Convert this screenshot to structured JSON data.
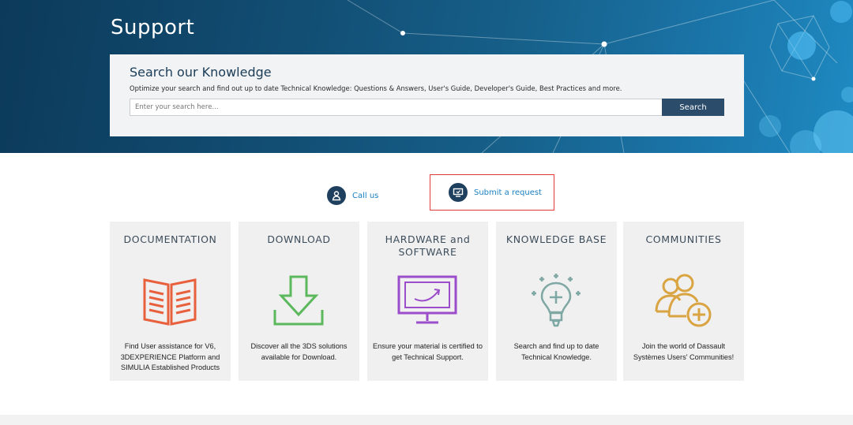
{
  "hero": {
    "title": "Support"
  },
  "search": {
    "title": "Search our Knowledge",
    "subtitle": "Optimize your search and find out up to date Technical Knowledge: Questions & Answers, User's Guide, Developer's Guide, Best Practices and more.",
    "placeholder": "Enter your search here...",
    "button_label": "Search"
  },
  "contact": {
    "call_label": "Call us",
    "request_label": "Submit a request"
  },
  "cards": [
    {
      "title": "DOCUMENTATION",
      "icon": "open-book-icon",
      "color": "#e8603c",
      "description": "Find User assistance for V6, 3DEXPERIENCE Platform and SIMULIA Established Products"
    },
    {
      "title": "DOWNLOAD",
      "icon": "download-arrow-icon",
      "color": "#5cb85c",
      "description": "Discover all the 3DS solutions available for Download."
    },
    {
      "title": "HARDWARE and SOFTWARE",
      "icon": "monitor-icon",
      "color": "#9b4dca",
      "description": "Ensure your material is certified to get Technical Support."
    },
    {
      "title": "KNOWLEDGE BASE",
      "icon": "lightbulb-icon",
      "color": "#7fa8a4",
      "description": "Search and find up to date Technical Knowledge."
    },
    {
      "title": "COMMUNITIES",
      "icon": "users-plus-icon",
      "color": "#d9a441",
      "description": "Join the world of Dassault Systèmes Users' Communities!"
    }
  ],
  "colors": {
    "hero_dark": "#0c3a5a",
    "hero_light": "#1e8ac2",
    "link_blue": "#1a7fc0",
    "button_navy": "#2c4c6b",
    "highlight_red": "#e03a3a"
  }
}
